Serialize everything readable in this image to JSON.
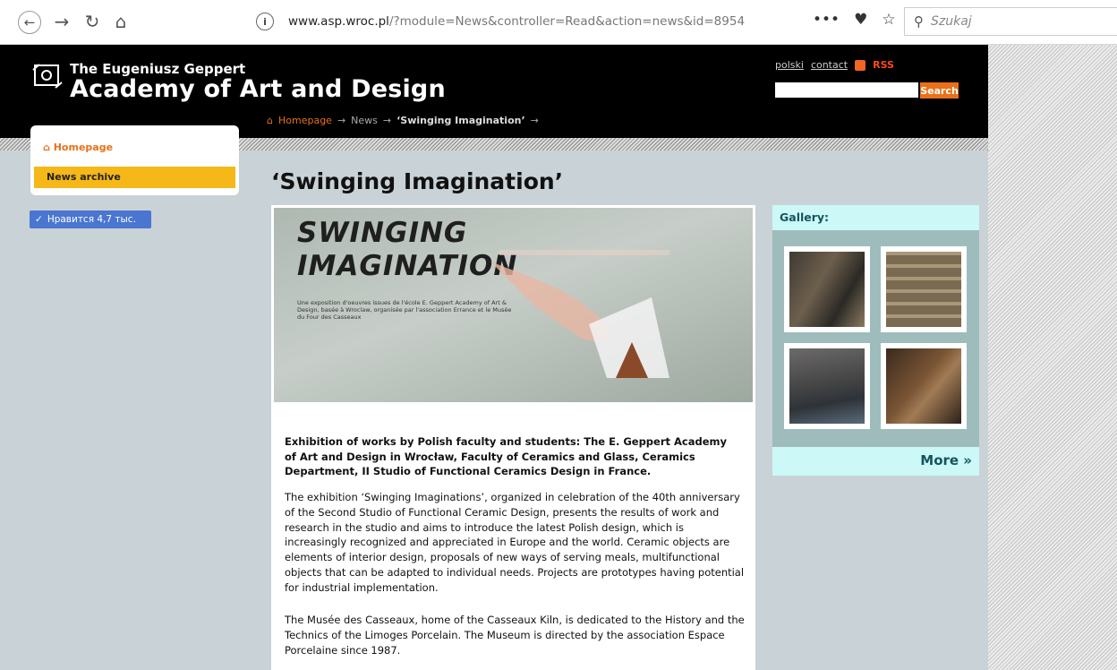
{
  "browser": {
    "url_host": "www.asp.wroc.pl",
    "url_path": "/?module=News&controller=Read&action=news&id=8954",
    "search_placeholder": "Szukaj",
    "icons": [
      "back-icon",
      "forward-icon",
      "reload-icon",
      "home-icon",
      "info-icon",
      "more-icon",
      "pocket-icon",
      "star-icon",
      "search-icon"
    ]
  },
  "header": {
    "subtitle": "The Eugeniusz Geppert",
    "title": "Academy of Art and Design",
    "links": {
      "polski": "polski",
      "contact": "contact",
      "rss": "RSS"
    },
    "search_button": "Search"
  },
  "breadcrumb": {
    "home": "Homepage",
    "news": "News",
    "current": "‘Swinging Imagination’"
  },
  "sidebar": {
    "home": "Homepage",
    "archive": "News archive",
    "like": "Нравится 4,7 тыс."
  },
  "article": {
    "title": "‘Swinging Imagination’",
    "hero_title_1": "SWINGING",
    "hero_title_2": "IMAGINATION",
    "hero_caption": "Une exposition d'oeuvres issues de l'école E. Geppert Academy of Art & Design, basée à Wroclaw, organisée par l'association Errance et le Musée du Four des Casseaux",
    "lead": "Exhibition of works by Polish faculty and students: The E. Geppert Academy of Art and Design in Wrocław, Faculty of Ceramics and Glass, Ceramics Department, II Studio of Functional Ceramics Design in France.",
    "p1": "The exhibition ‘Swinging Imaginations’, organized in celebration of the 40th anniversary of the Second Studio of Functional Ceramic Design, presents the results of work and research in the studio and aims to introduce the latest Polish design, which is increasingly recognized and appreciated in Europe and the world. Ceramic objects are elements of interior design, proposals of new ways of serving meals, multifunctional objects that can be adapted to individual needs. Projects are prototypes having potential for industrial implementation.",
    "p2": "The Musée des Casseaux, home of the Casseaux Kiln, is dedicated to the History and the Technics of the Limoges Porcelain. The Museum is directed by the association Espace Porcelaine since 1987."
  },
  "gallery": {
    "heading": "Gallery:",
    "more": "More »"
  },
  "colors": {
    "accent": "#e8711a",
    "archive_highlight": "#f5b818",
    "gallery_bg": "#9fbcbc",
    "gallery_head": "#ccf8f8",
    "like_button": "#4a76d1"
  }
}
